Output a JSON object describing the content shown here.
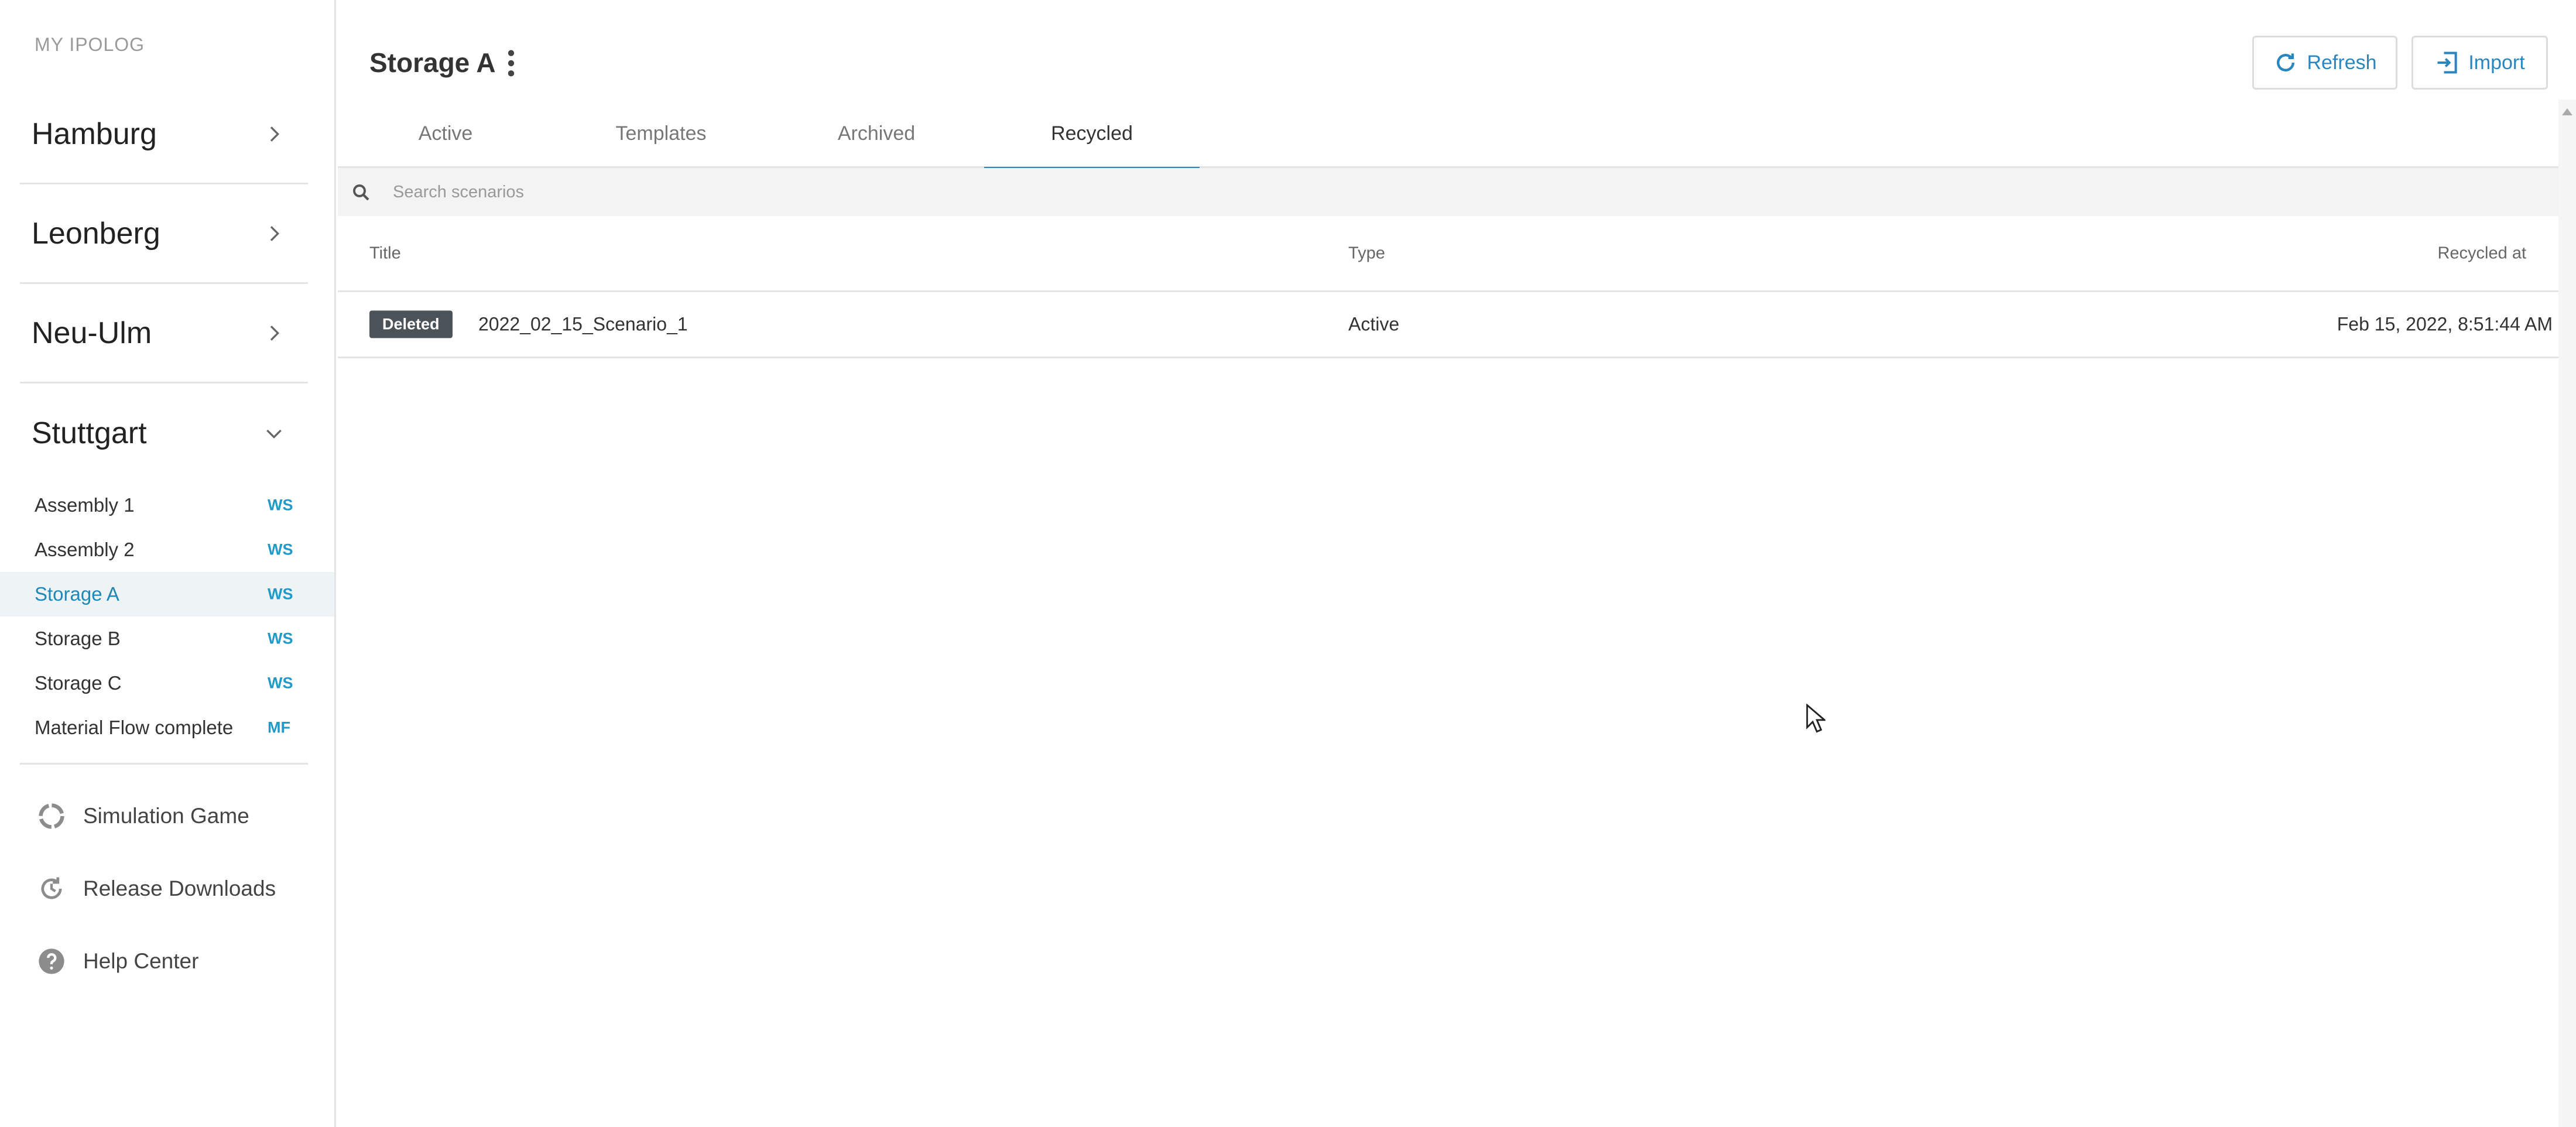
{
  "sidebar": {
    "brand": "MY IPOLOG",
    "sites": [
      {
        "label": "Hamburg",
        "expanded": false
      },
      {
        "label": "Leonberg",
        "expanded": false
      },
      {
        "label": "Neu-Ulm",
        "expanded": false
      },
      {
        "label": "Stuttgart",
        "expanded": true
      }
    ],
    "subitems": [
      {
        "label": "Assembly 1",
        "badge": "WS"
      },
      {
        "label": "Assembly 2",
        "badge": "WS"
      },
      {
        "label": "Storage A",
        "badge": "WS",
        "active": true
      },
      {
        "label": "Storage B",
        "badge": "WS"
      },
      {
        "label": "Storage C",
        "badge": "WS"
      },
      {
        "label": "Material Flow complete",
        "badge": "MF"
      }
    ],
    "footer": [
      {
        "label": "Simulation Game",
        "icon": "circle-segments-icon"
      },
      {
        "label": "Release Downloads",
        "icon": "history-icon"
      },
      {
        "label": "Help Center",
        "icon": "help-icon"
      }
    ]
  },
  "header": {
    "title": "Storage A",
    "refresh_label": "Refresh",
    "import_label": "Import"
  },
  "tabs": [
    {
      "label": "Active"
    },
    {
      "label": "Templates"
    },
    {
      "label": "Archived"
    },
    {
      "label": "Recycled",
      "active": true
    }
  ],
  "search": {
    "placeholder": "Search scenarios",
    "value": ""
  },
  "table": {
    "columns": {
      "title": "Title",
      "type": "Type",
      "recycled_at": "Recycled at"
    },
    "rows": [
      {
        "status": "Deleted",
        "title": "2022_02_15_Scenario_1",
        "type": "Active",
        "recycled_at": "Feb 15, 2022, 8:51:44 AM"
      }
    ]
  },
  "colors": {
    "accent": "#2a86bf",
    "badge_blue": "#1f9ac9",
    "deleted_badge": "#4b5358",
    "active_bg": "#eef3f6"
  }
}
